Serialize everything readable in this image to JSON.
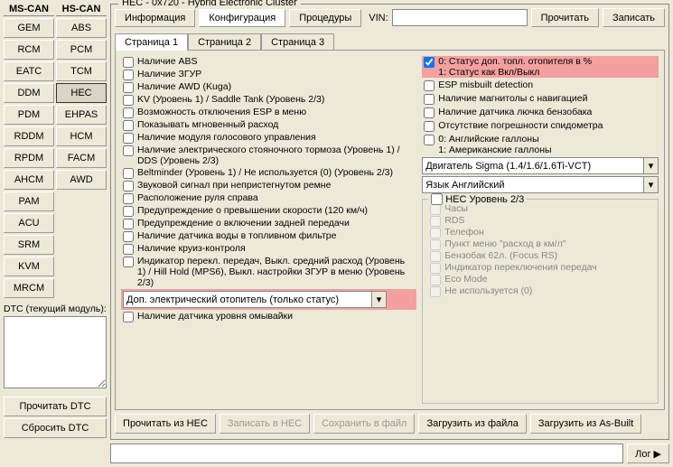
{
  "buses": {
    "ms": {
      "header": "MS-CAN",
      "modules": [
        "GEM",
        "RCM",
        "EATC",
        "DDM",
        "PDM",
        "RDDM",
        "RPDM",
        "AHCM",
        "PAM",
        "ACU",
        "SRM",
        "KVM",
        "MRCM"
      ]
    },
    "hs": {
      "header": "HS-CAN",
      "modules": [
        "ABS",
        "PCM",
        "TCM",
        "HEC",
        "EHPAS",
        "HCM",
        "FACM",
        "AWD"
      ]
    }
  },
  "hs_selected": "HEC",
  "frame_title": "HEC - 0x720 - Hybrid Electronic Cluster",
  "top_tabs": {
    "info": "Информация",
    "config": "Конфигурация",
    "proc": "Процедуры"
  },
  "vin_label": "VIN:",
  "vin_value": "",
  "btn_read": "Прочитать",
  "btn_write": "Записать",
  "sub_tabs": {
    "p1": "Страница 1",
    "p2": "Страница 2",
    "p3": "Страница 3"
  },
  "left_checks": [
    "Наличие ABS",
    "Наличие ЗГУР",
    "Наличие AWD (Kuga)",
    "KV (Уровень 1) / Saddle Tank (Уровень 2/3)",
    "Возможность отключения ESP в меню",
    "Показывать мгновенный расход",
    "Наличие модуля голосового управления",
    "Наличие электрического стояночного тормоза (Уровень 1) / DDS (Уровень 2/3)",
    "Beltminder (Уровень 1) / Не используется (0) (Уровень 2/3)",
    "Звуковой сигнал при непристегнутом ремне",
    "Расположение руля справа",
    "Предупреждение о превышении скорости (120 км/ч)",
    "Предупреждение о включении задней передачи",
    "Наличие датчика воды в топливном фильтре",
    "Наличие круиз-контроля",
    "Индикатор перекл. передач, Выкл. средний расход (Уровень 1) / Hill Hold (MPS6), Выкл. настройки ЗГУР в меню  (Уровень 2/3)"
  ],
  "left_combo": "Доп. электрический отопитель (только статус)",
  "left_post_check": "Наличие датчика уровня омывайки",
  "right_top_check": "0: Статус доп. топл. отопителя в %\n1: Статус как Вкл/Выкл",
  "right_checks": [
    "ESP misbuilt detection",
    "Наличие магнитолы с навигацией",
    "Наличие датчика лючка бензобака",
    "Отсутствие погрешности спидометра"
  ],
  "right_gallon": "0: Английские галлоны\n1: Американские галлоны",
  "combo_engine": "Двигатель Sigma (1.4/1.6/1.6Ti-VCT)",
  "combo_lang": "Язык Английский",
  "group_title": "HEC Уровень 2/3",
  "group_items": [
    "Часы",
    "RDS",
    "Телефон",
    "Пункт меню \"расход в км/л\"",
    "Бензобак 62л. (Focus RS)",
    "Индикатор переключения передач",
    "Eco Mode",
    "Не используется (0)"
  ],
  "bottom_btns": {
    "read_hec": "Прочитать из HEC",
    "write_hec": "Записать в HEC",
    "save_file": "Сохранить в файл",
    "load_file": "Загрузить из файла",
    "load_asbuilt": "Загрузить из As-Built"
  },
  "dtc": {
    "label": "DTC (текущий модуль):",
    "value": "",
    "btn_read": "Прочитать DTC",
    "btn_clear": "Сбросить DTC"
  },
  "log_btn": "Лог ▶"
}
